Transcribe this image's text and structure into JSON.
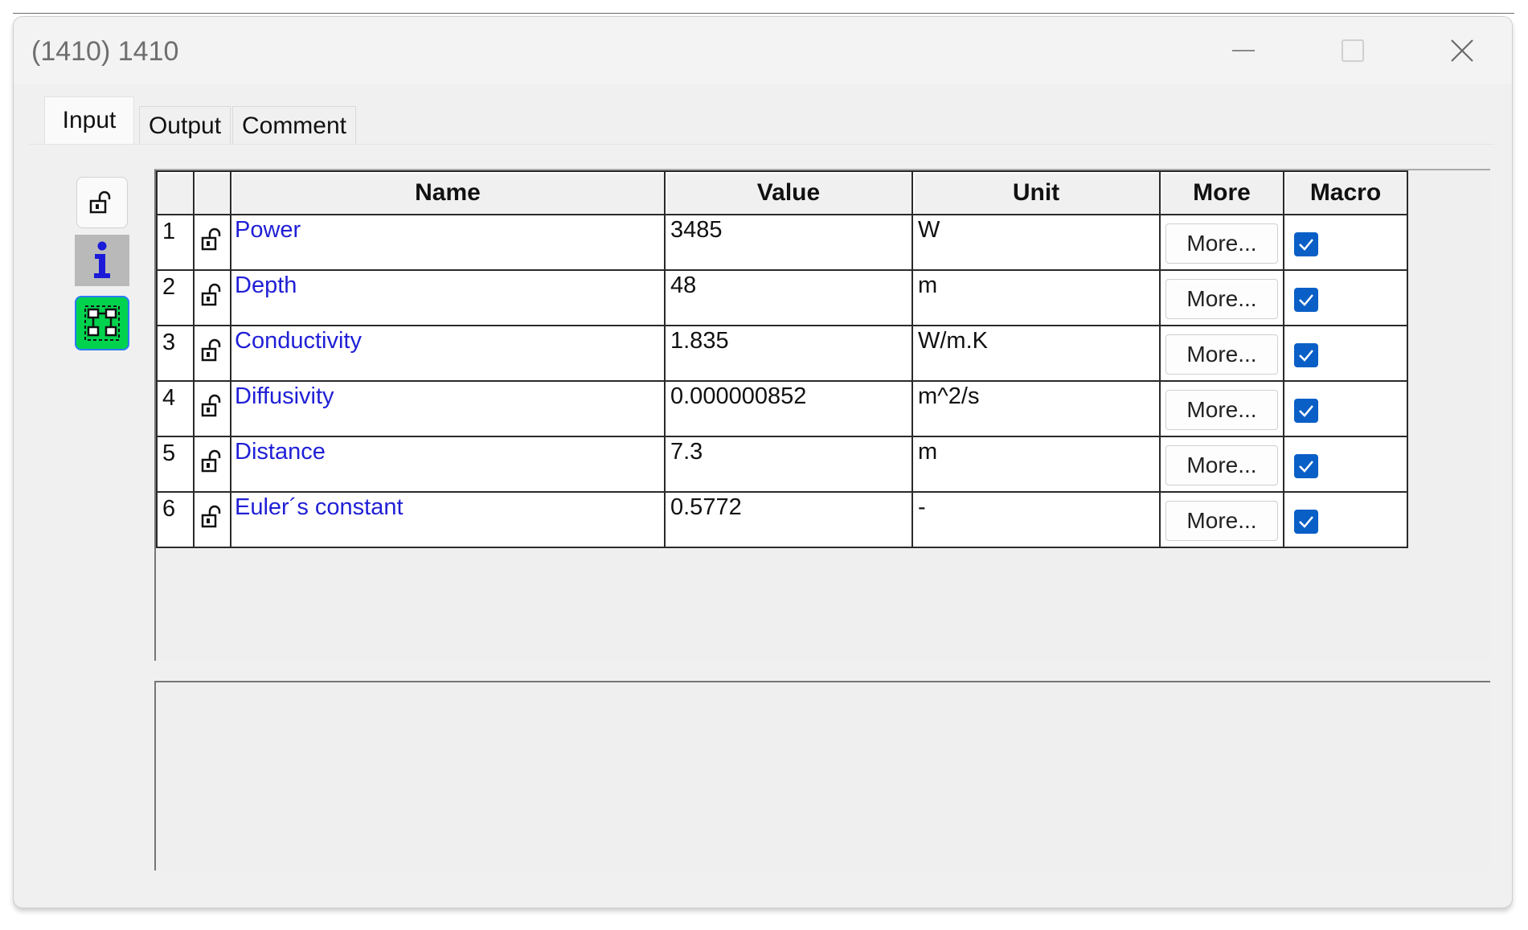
{
  "window": {
    "title": "(1410) 1410"
  },
  "tabs": [
    {
      "label": "Input",
      "active": true
    },
    {
      "label": "Output",
      "active": false
    },
    {
      "label": "Comment",
      "active": false
    }
  ],
  "sidebar": {
    "buttons": [
      {
        "icon": "lock-icon"
      },
      {
        "icon": "info-icon"
      },
      {
        "icon": "network-icon"
      }
    ]
  },
  "grid": {
    "columns": [
      "",
      "",
      "Name",
      "Value",
      "Unit",
      "More",
      "Macro"
    ],
    "rows": [
      {
        "num": "1",
        "name": "Power",
        "value": "3485",
        "unit": "W",
        "more": "More...",
        "macro": true
      },
      {
        "num": "2",
        "name": "Depth",
        "value": "48",
        "unit": "m",
        "more": "More...",
        "macro": true
      },
      {
        "num": "3",
        "name": "Conductivity",
        "value": "1.835",
        "unit": "W/m.K",
        "more": "More...",
        "macro": true
      },
      {
        "num": "4",
        "name": "Diffusivity",
        "value": "0.000000852",
        "unit": "m^2/s",
        "more": "More...",
        "macro": true
      },
      {
        "num": "5",
        "name": "Distance",
        "value": "7.3",
        "unit": "m",
        "more": "More...",
        "macro": true
      },
      {
        "num": "6",
        "name": "Euler´s constant",
        "value": "0.5772",
        "unit": "-",
        "more": "More...",
        "macro": true
      }
    ]
  },
  "colors": {
    "name_text": "#1f1fd6",
    "checkbox": "#0a5fc7",
    "network_icon_bg": "#00d24e"
  }
}
